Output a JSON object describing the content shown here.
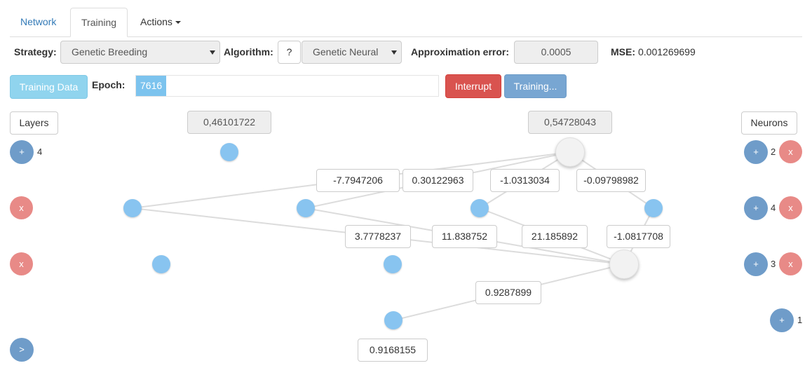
{
  "tabs": [
    {
      "label": "Network"
    },
    {
      "label": "Training"
    },
    {
      "label": "Actions"
    }
  ],
  "config": {
    "strategy_label": "Strategy:",
    "strategy_value": "Genetic Breeding",
    "algorithm_label": "Algorithm:",
    "algorithm_help": "?",
    "algorithm_value": "Genetic Neural",
    "approx_label": "Approximation error:",
    "approx_value": "0.0005",
    "mse_label": "MSE:",
    "mse_value": "0.001269699"
  },
  "training": {
    "data_button": "Training Data",
    "epoch_label": "Epoch:",
    "epoch_value": "7616",
    "epoch_progress": 0.1,
    "interrupt_button": "Interrupt",
    "status_button": "Training..."
  },
  "network": {
    "layers_button": "Layers",
    "neurons_button": "Neurons",
    "inputs": [
      "0,46101722",
      "0,54728043"
    ],
    "output": "0.9168155",
    "weights_top": [
      "-7.7947206",
      "0.30122963",
      "-1.0313034",
      "-0.09798982"
    ],
    "weights_mid": [
      "3.7778237",
      "11.838752",
      "21.185892",
      "-1.0817708"
    ],
    "weight_bottom": "0.9287899"
  },
  "rows": [
    {
      "layer_count": "4",
      "neuron_count": "2"
    },
    {
      "neuron_count": "4"
    },
    {
      "neuron_count": "3"
    },
    {
      "neuron_count": "1"
    }
  ],
  "controls": {
    "add": "+",
    "remove": "x",
    "next": ">"
  },
  "colors": {
    "neuron": "#88c4f0",
    "node_light": "#f2f2f2",
    "add_button": "#6f9cc9",
    "remove_button": "#e88a87"
  }
}
